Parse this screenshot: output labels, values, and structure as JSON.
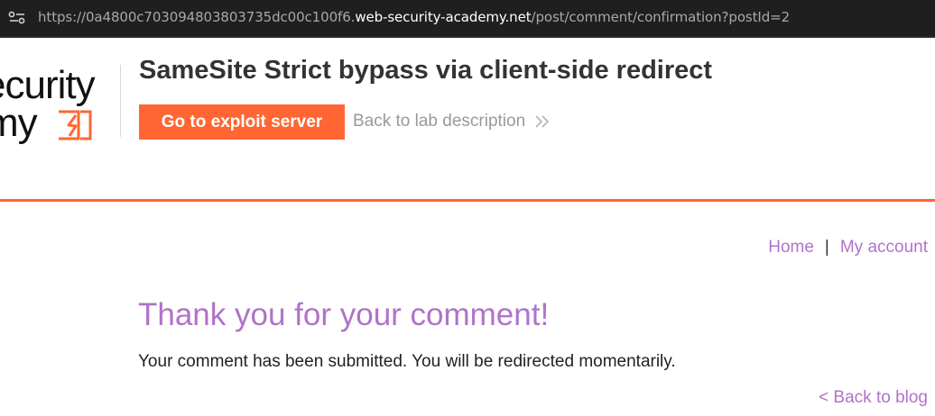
{
  "browser": {
    "url_prefix": "https://0a4800c703094803803735dc00c100f6.",
    "url_host": "web-security-academy.net",
    "url_path": "/post/comment/confirmation?postId=2"
  },
  "lab_header": {
    "logo_line1": "ecurity",
    "logo_line2": "my",
    "title": "SameSite Strict bypass via client-side redirect",
    "exploit_button": "Go to exploit server",
    "back_link": "Back to lab description"
  },
  "nav": {
    "home": "Home",
    "separator": "|",
    "account": "My account"
  },
  "main": {
    "heading": "Thank you for your comment!",
    "message": "Your comment has been submitted. You will be redirected momentarily.",
    "back_to_blog": "< Back to blog"
  },
  "colors": {
    "accent_orange": "#ff6633",
    "link_purple": "#b073c8",
    "address_bar_bg": "#1f1f1f"
  },
  "icons": [
    "site-info-icon",
    "lightning-logo-icon",
    "double-chevron-right-icon"
  ]
}
